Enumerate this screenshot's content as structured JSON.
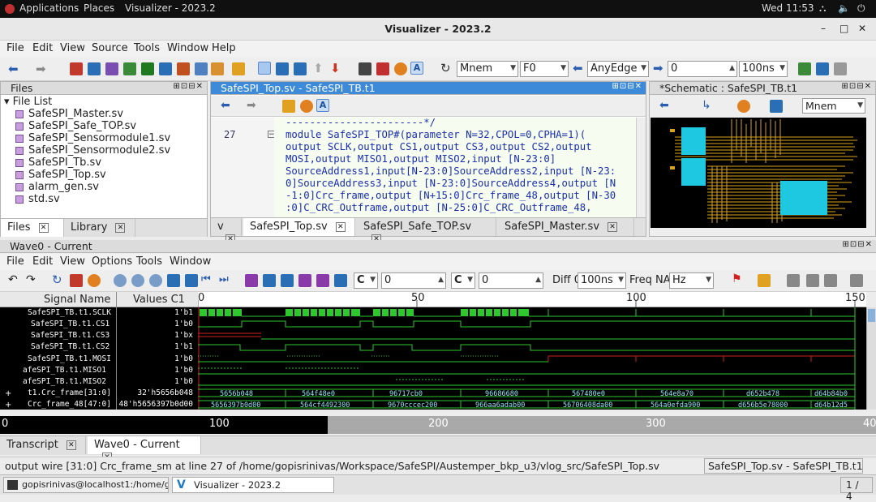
{
  "system_bar": {
    "applications": "Applications",
    "places": "Places",
    "app": "Visualizer - 2023.2",
    "clock": "Wed 11:53"
  },
  "window": {
    "title": "Visualizer - 2023.2"
  },
  "menu": [
    "File",
    "Edit",
    "View",
    "Source",
    "Tools",
    "Window",
    "Help"
  ],
  "toolbar": {
    "mnem": "Mnem",
    "f0": "F0",
    "edge": "AnyEdge",
    "time_value": "0",
    "time_unit": "100ns"
  },
  "files_pane": {
    "title": "Files",
    "root": "File List",
    "files": [
      "SafeSPI_Master.sv",
      "SafeSPI_Safe_TOP.sv",
      "SafeSPI_Sensormodule1.sv",
      "SafeSPI_Sensormodule2.sv",
      "SafeSPI_Tb.sv",
      "SafeSPI_Top.sv",
      "alarm_gen.sv",
      "std.sv"
    ],
    "tabs": [
      "Files",
      "Library"
    ]
  },
  "editor": {
    "title": "SafeSPI_Top.sv - SafeSPI_TB.t1",
    "line_number": "27",
    "lines": [
      "-----------------------*/",
      "module SafeSPI_TOP#(parameter N=32,CPOL=0,CPHA=1)(",
      "output SCLK,output CS1,output CS3,output CS2,output",
      "MOSI,output MISO1,output MISO2,input [N-23:0]",
      "SourceAddress1,input[N-23:0]SourceAddress2,input [N-23:",
      "0]SourceAddress3,input [N-23:0]SourceAddress4,output [N",
      "-1:0]Crc_frame,output [N+15:0]Crc_frame_48,output [N-30",
      ":0]C_CRC_Outframe,output [N-25:0]C_CRC_Outframe_48,"
    ],
    "tabs": [
      "v",
      "SafeSPI_Top.sv",
      "SafeSPI_Safe_TOP.sv",
      "SafeSPI_Master.sv"
    ]
  },
  "schematic": {
    "title": "*Schematic : SafeSPI_TB.t1",
    "mode": "Mnem"
  },
  "wave": {
    "title": "Wave0 - Current",
    "menu": [
      "File",
      "Edit",
      "View",
      "Options",
      "Tools",
      "Window"
    ],
    "cursor_a": "0",
    "cursor_b": "0",
    "diff_label": "Diff 0",
    "diff_unit": "100ns",
    "freq_label": "Freq NA",
    "freq_unit": "Hz",
    "col_signal": "Signal Name",
    "col_values": "Values C1",
    "timeline_ticks": [
      "0",
      "50",
      "100",
      "150"
    ],
    "overview_ticks": [
      "0",
      "100",
      "200",
      "300",
      "40"
    ],
    "signals": [
      {
        "name": "SafeSPI_TB.t1.SCLK",
        "value": "1'b1"
      },
      {
        "name": "SafeSPI_TB.t1.CS1",
        "value": "1'b0"
      },
      {
        "name": "SafeSPI_TB.t1.CS3",
        "value": "1'bx"
      },
      {
        "name": "SafeSPI_TB.t1.CS2",
        "value": "1'b1"
      },
      {
        "name": "SafeSPI_TB.t1.MOSI",
        "value": "1'b0"
      },
      {
        "name": "afeSPI_TB.t1.MISO1",
        "value": "1'b0"
      },
      {
        "name": "afeSPI_TB.t1.MISO2",
        "value": "1'b0"
      },
      {
        "name": "t1.Crc_frame[31:0]",
        "value": "32'h5656b048"
      },
      {
        "name": "Crc_frame_48[47:0]",
        "value": "48'h5656397b0d00"
      }
    ],
    "bus1": [
      "5656b048",
      "564f48e0",
      "96717cb0",
      "96686680",
      "567480e0",
      "564e8a70",
      "d652b478",
      "d64b84b0"
    ],
    "bus2": [
      "5656397b0d00",
      "564cf4492300",
      "9670cccec200",
      "966aa6adab00",
      "56706408da00",
      "564a0efda900",
      "d656b5e78000",
      "d64b12d5"
    ]
  },
  "bottom_tabs": [
    "Transcript",
    "Wave0 - Current"
  ],
  "status": {
    "message": "output wire [31:0] Crc_frame_sm  at line 27 of /home/gopisrinivas/Workspace/SafeSPI/Austemper_bkp_u3/vlog_src/SafeSPI_Top.sv",
    "context": "SafeSPI_Top.sv - SafeSPI_TB.t1"
  },
  "taskbar": {
    "terminal": "gopisrinivas@localhost1:/home/gopi...",
    "app": "Visualizer - 2023.2",
    "pager": "1 / 4"
  }
}
